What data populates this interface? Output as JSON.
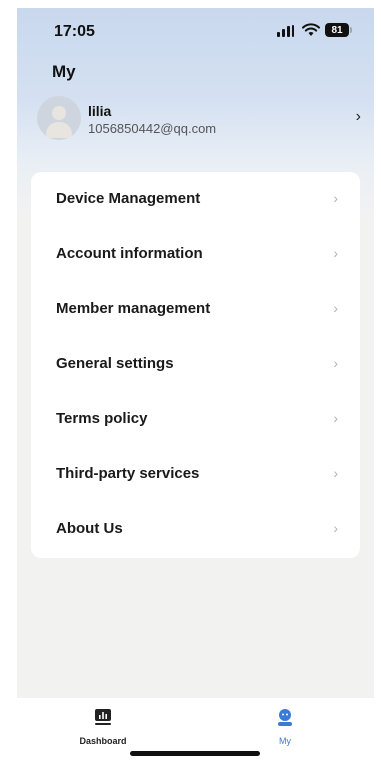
{
  "status_bar": {
    "time": "17:05",
    "battery": "81"
  },
  "page": {
    "title": "My"
  },
  "profile": {
    "name": "lilia",
    "email": "1056850442@qq.com",
    "chevron": "›"
  },
  "menu": {
    "chevron": "›",
    "items": [
      {
        "label": "Device Management"
      },
      {
        "label": "Account information"
      },
      {
        "label": "Member management"
      },
      {
        "label": "General settings"
      },
      {
        "label": "Terms policy"
      },
      {
        "label": "Third-party services"
      },
      {
        "label": "About Us"
      }
    ]
  },
  "tab_bar": {
    "tabs": [
      {
        "label": "Dashboard",
        "icon": "dashboard-chart-icon",
        "active": false
      },
      {
        "label": "My",
        "icon": "user-profile-icon",
        "active": true
      }
    ]
  },
  "colors": {
    "accent": "#3a7bd5",
    "header_gradient_top": "#c9d8ee",
    "background": "#f2f2f1"
  }
}
